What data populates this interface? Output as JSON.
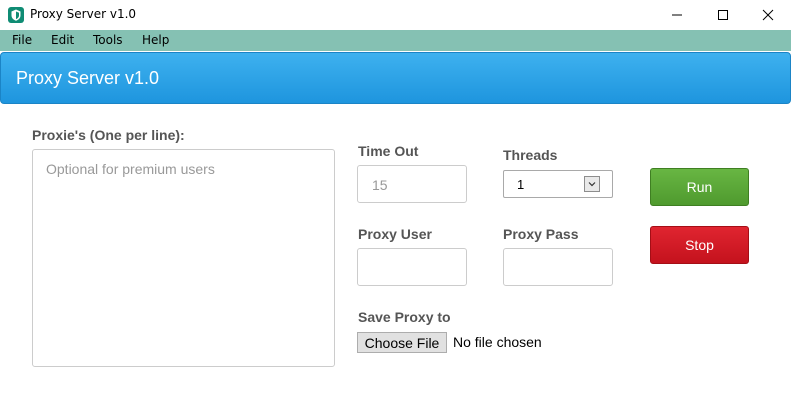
{
  "window": {
    "title": "Proxy Server v1.0",
    "controls": {
      "minimize": "minimize-icon",
      "maximize": "maximize-icon",
      "close": "close-icon"
    }
  },
  "menu": {
    "items": [
      "File",
      "Edit",
      "Tools",
      "Help"
    ]
  },
  "header": {
    "title": "Proxy Server v1.0"
  },
  "form": {
    "proxies_label": "Proxie's (One per line):",
    "proxies_placeholder": "Optional for premium users",
    "timeout_label": "Time Out",
    "timeout_value": "15",
    "threads_label": "Threads",
    "threads_selected": "1",
    "proxy_user_label": "Proxy User",
    "proxy_user_value": "",
    "proxy_pass_label": "Proxy Pass",
    "proxy_pass_value": "",
    "save_proxy_label": "Save Proxy to",
    "choose_file_label": "Choose File",
    "file_status": "No file chosen"
  },
  "buttons": {
    "run": "Run",
    "stop": "Stop"
  },
  "colors": {
    "menubar": "#85c1b3",
    "header": "#2aa3e8",
    "run": "#5ea83a",
    "stop": "#d61a25"
  }
}
